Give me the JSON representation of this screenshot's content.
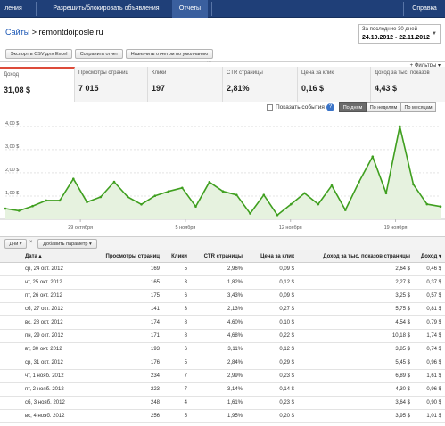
{
  "nav": {
    "tabs": [
      "ления",
      "Разрешить/блокировать объявления",
      "Отчеты",
      "Справка"
    ]
  },
  "header": {
    "breadcrumb_link": "Сайты",
    "breadcrumb_sep": ">",
    "breadcrumb_current": "remontdoiposle.ru",
    "date_label": "За последние 30 дней",
    "date_range": "24.10.2012 - 22.11.2012",
    "date_dropdown": "▼"
  },
  "toolbar": {
    "export_label": "Экспорт в CSV для Excel",
    "save_label": "Сохранить отчет",
    "default_label": "Назначить отчетом по умолчанию",
    "filters_label": "+ Фильтры ▾",
    "grip": "⋯"
  },
  "metrics": [
    {
      "label": "Доход",
      "value": "31,08 $"
    },
    {
      "label": "Просмотры страниц",
      "value": "7 015"
    },
    {
      "label": "Клики",
      "value": "197"
    },
    {
      "label": "CTR страницы",
      "value": "2,81%"
    },
    {
      "label": "Цена за клик",
      "value": "0,16 $"
    },
    {
      "label": "Доход за тыс. показов",
      "value": "4,43 $"
    }
  ],
  "chart_controls": {
    "events_label": "Показать события",
    "help": "?",
    "granularity": [
      "По дням",
      "По неделям",
      "По месяцам"
    ],
    "selected": "По дням"
  },
  "chart_data": {
    "type": "area",
    "title": "",
    "xlabel": "",
    "ylabel": "",
    "ylim": [
      0,
      4.3
    ],
    "yticks": [
      1.0,
      2.0,
      3.0,
      4.0
    ],
    "ytick_labels": [
      "1,00 $",
      "2,00 $",
      "3,00 $",
      "4,00 $"
    ],
    "xtick_labels": [
      "29 октября",
      "5 ноября",
      "12 ноября",
      "19 ноября"
    ],
    "xtick_dates": [
      "2012-10-29",
      "2012-11-05",
      "2012-11-12",
      "2012-11-19"
    ],
    "x": [
      "2012-10-24",
      "2012-10-25",
      "2012-10-26",
      "2012-10-27",
      "2012-10-28",
      "2012-10-29",
      "2012-10-30",
      "2012-10-31",
      "2012-11-01",
      "2012-11-02",
      "2012-11-03",
      "2012-11-04",
      "2012-11-05",
      "2012-11-06",
      "2012-11-07",
      "2012-11-08",
      "2012-11-09",
      "2012-11-10",
      "2012-11-11",
      "2012-11-12",
      "2012-11-13",
      "2012-11-14",
      "2012-11-15",
      "2012-11-16",
      "2012-11-17",
      "2012-11-18",
      "2012-11-19",
      "2012-11-20",
      "2012-11-21",
      "2012-11-22"
    ],
    "series": [
      {
        "name": "Доход",
        "values": [
          0.46,
          0.37,
          0.57,
          0.81,
          0.81,
          1.74,
          0.74,
          0.96,
          1.61,
          0.96,
          0.64,
          1.01,
          1.2,
          1.35,
          0.55,
          1.6,
          1.2,
          1.05,
          0.25,
          1.05,
          0.18,
          0.65,
          1.12,
          0.65,
          1.45,
          0.4,
          1.6,
          2.7,
          1.12,
          4.0,
          1.5,
          0.65,
          0.55
        ]
      }
    ],
    "grid": true,
    "color": "#3f9f1f",
    "fill": "#e6f2df"
  },
  "dim_bar": {
    "dim_label": "Дни ▾",
    "x": "×",
    "add_label": "Добавить параметр ▾"
  },
  "table": {
    "columns": [
      "Дата ▴",
      "Просмотры страниц",
      "Клики",
      "CTR страницы",
      "Цена за клик",
      "Доход за тыс. показов страницы",
      "Доход ▾"
    ],
    "rows": [
      [
        "ср, 24 окт. 2012",
        "169",
        "5",
        "2,96%",
        "0,09 $",
        "2,64 $",
        "0,46 $"
      ],
      [
        "чт, 25 окт. 2012",
        "165",
        "3",
        "1,82%",
        "0,12 $",
        "2,27 $",
        "0,37 $"
      ],
      [
        "пт, 26 окт. 2012",
        "175",
        "6",
        "3,43%",
        "0,09 $",
        "3,25 $",
        "0,57 $"
      ],
      [
        "сб, 27 окт. 2012",
        "141",
        "3",
        "2,13%",
        "0,27 $",
        "5,75 $",
        "0,81 $"
      ],
      [
        "вс, 28 окт. 2012",
        "174",
        "8",
        "4,60%",
        "0,10 $",
        "4,54 $",
        "0,79 $"
      ],
      [
        "пн, 29 окт. 2012",
        "171",
        "8",
        "4,68%",
        "0,22 $",
        "10,18 $",
        "1,74 $"
      ],
      [
        "вт, 30 окт. 2012",
        "193",
        "6",
        "3,11%",
        "0,12 $",
        "3,85 $",
        "0,74 $"
      ],
      [
        "ср, 31 окт. 2012",
        "176",
        "5",
        "2,84%",
        "0,29 $",
        "5,45 $",
        "0,96 $"
      ],
      [
        "чт, 1 нояб. 2012",
        "234",
        "7",
        "2,99%",
        "0,23 $",
        "6,89 $",
        "1,61 $"
      ],
      [
        "пт, 2 нояб. 2012",
        "223",
        "7",
        "3,14%",
        "0,14 $",
        "4,30 $",
        "0,96 $"
      ],
      [
        "сб, 3 нояб. 2012",
        "248",
        "4",
        "1,61%",
        "0,23 $",
        "3,64 $",
        "0,90 $"
      ],
      [
        "вс, 4 нояб. 2012",
        "256",
        "5",
        "1,95%",
        "0,20 $",
        "3,95 $",
        "1,01 $"
      ]
    ]
  }
}
